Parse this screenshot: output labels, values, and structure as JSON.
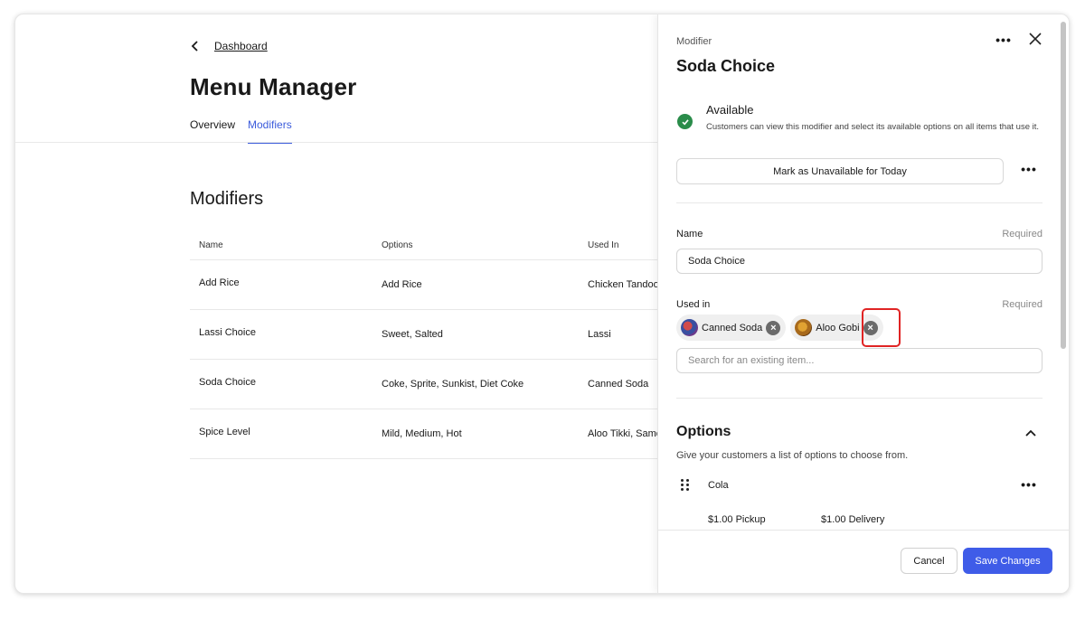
{
  "breadcrumb": {
    "label": "Dashboard"
  },
  "page": {
    "title": "Menu Manager"
  },
  "tabs": [
    {
      "label": "Overview",
      "active": false
    },
    {
      "label": "Modifiers",
      "active": true
    }
  ],
  "modifiers": {
    "title": "Modifiers",
    "columns": [
      "Name",
      "Options",
      "Used In"
    ],
    "rows": [
      {
        "name": "Add Rice",
        "options": "Add Rice",
        "used_in": "Chicken Tandoori"
      },
      {
        "name": "Lassi Choice",
        "options": "Sweet, Salted",
        "used_in": "Lassi"
      },
      {
        "name": "Soda Choice",
        "options": "Coke, Sprite, Sunkist, Diet Coke",
        "used_in": "Canned Soda"
      },
      {
        "name": "Spice Level",
        "options": "Mild, Medium, Hot",
        "used_in": "Aloo Tikki, Samosa"
      }
    ]
  },
  "panel": {
    "kicker": "Modifier",
    "title": "Soda Choice",
    "more_icon": "ellipsis-icon",
    "close_icon": "close-icon",
    "availability": {
      "title": "Available",
      "description": "Customers can view this modifier and select its available options on all items that use it.",
      "status_color": "#2a8c4a",
      "button_label": "Mark as Unavailable for Today"
    },
    "name_field": {
      "label": "Name",
      "required": "Required",
      "value": "Soda Choice"
    },
    "used_in": {
      "label": "Used in",
      "required": "Required",
      "chips": [
        {
          "label": "Canned Soda"
        },
        {
          "label": "Aloo Gobi"
        }
      ],
      "search_placeholder": "Search for an existing item..."
    },
    "options": {
      "title": "Options",
      "description": "Give your customers a list of options to choose from.",
      "items": [
        {
          "name": "Cola",
          "pickup": "$1.00 Pickup",
          "delivery": "$1.00 Delivery"
        }
      ]
    },
    "footer": {
      "cancel_label": "Cancel",
      "save_label": "Save Changes",
      "save_color": "#3f5ce8"
    }
  }
}
